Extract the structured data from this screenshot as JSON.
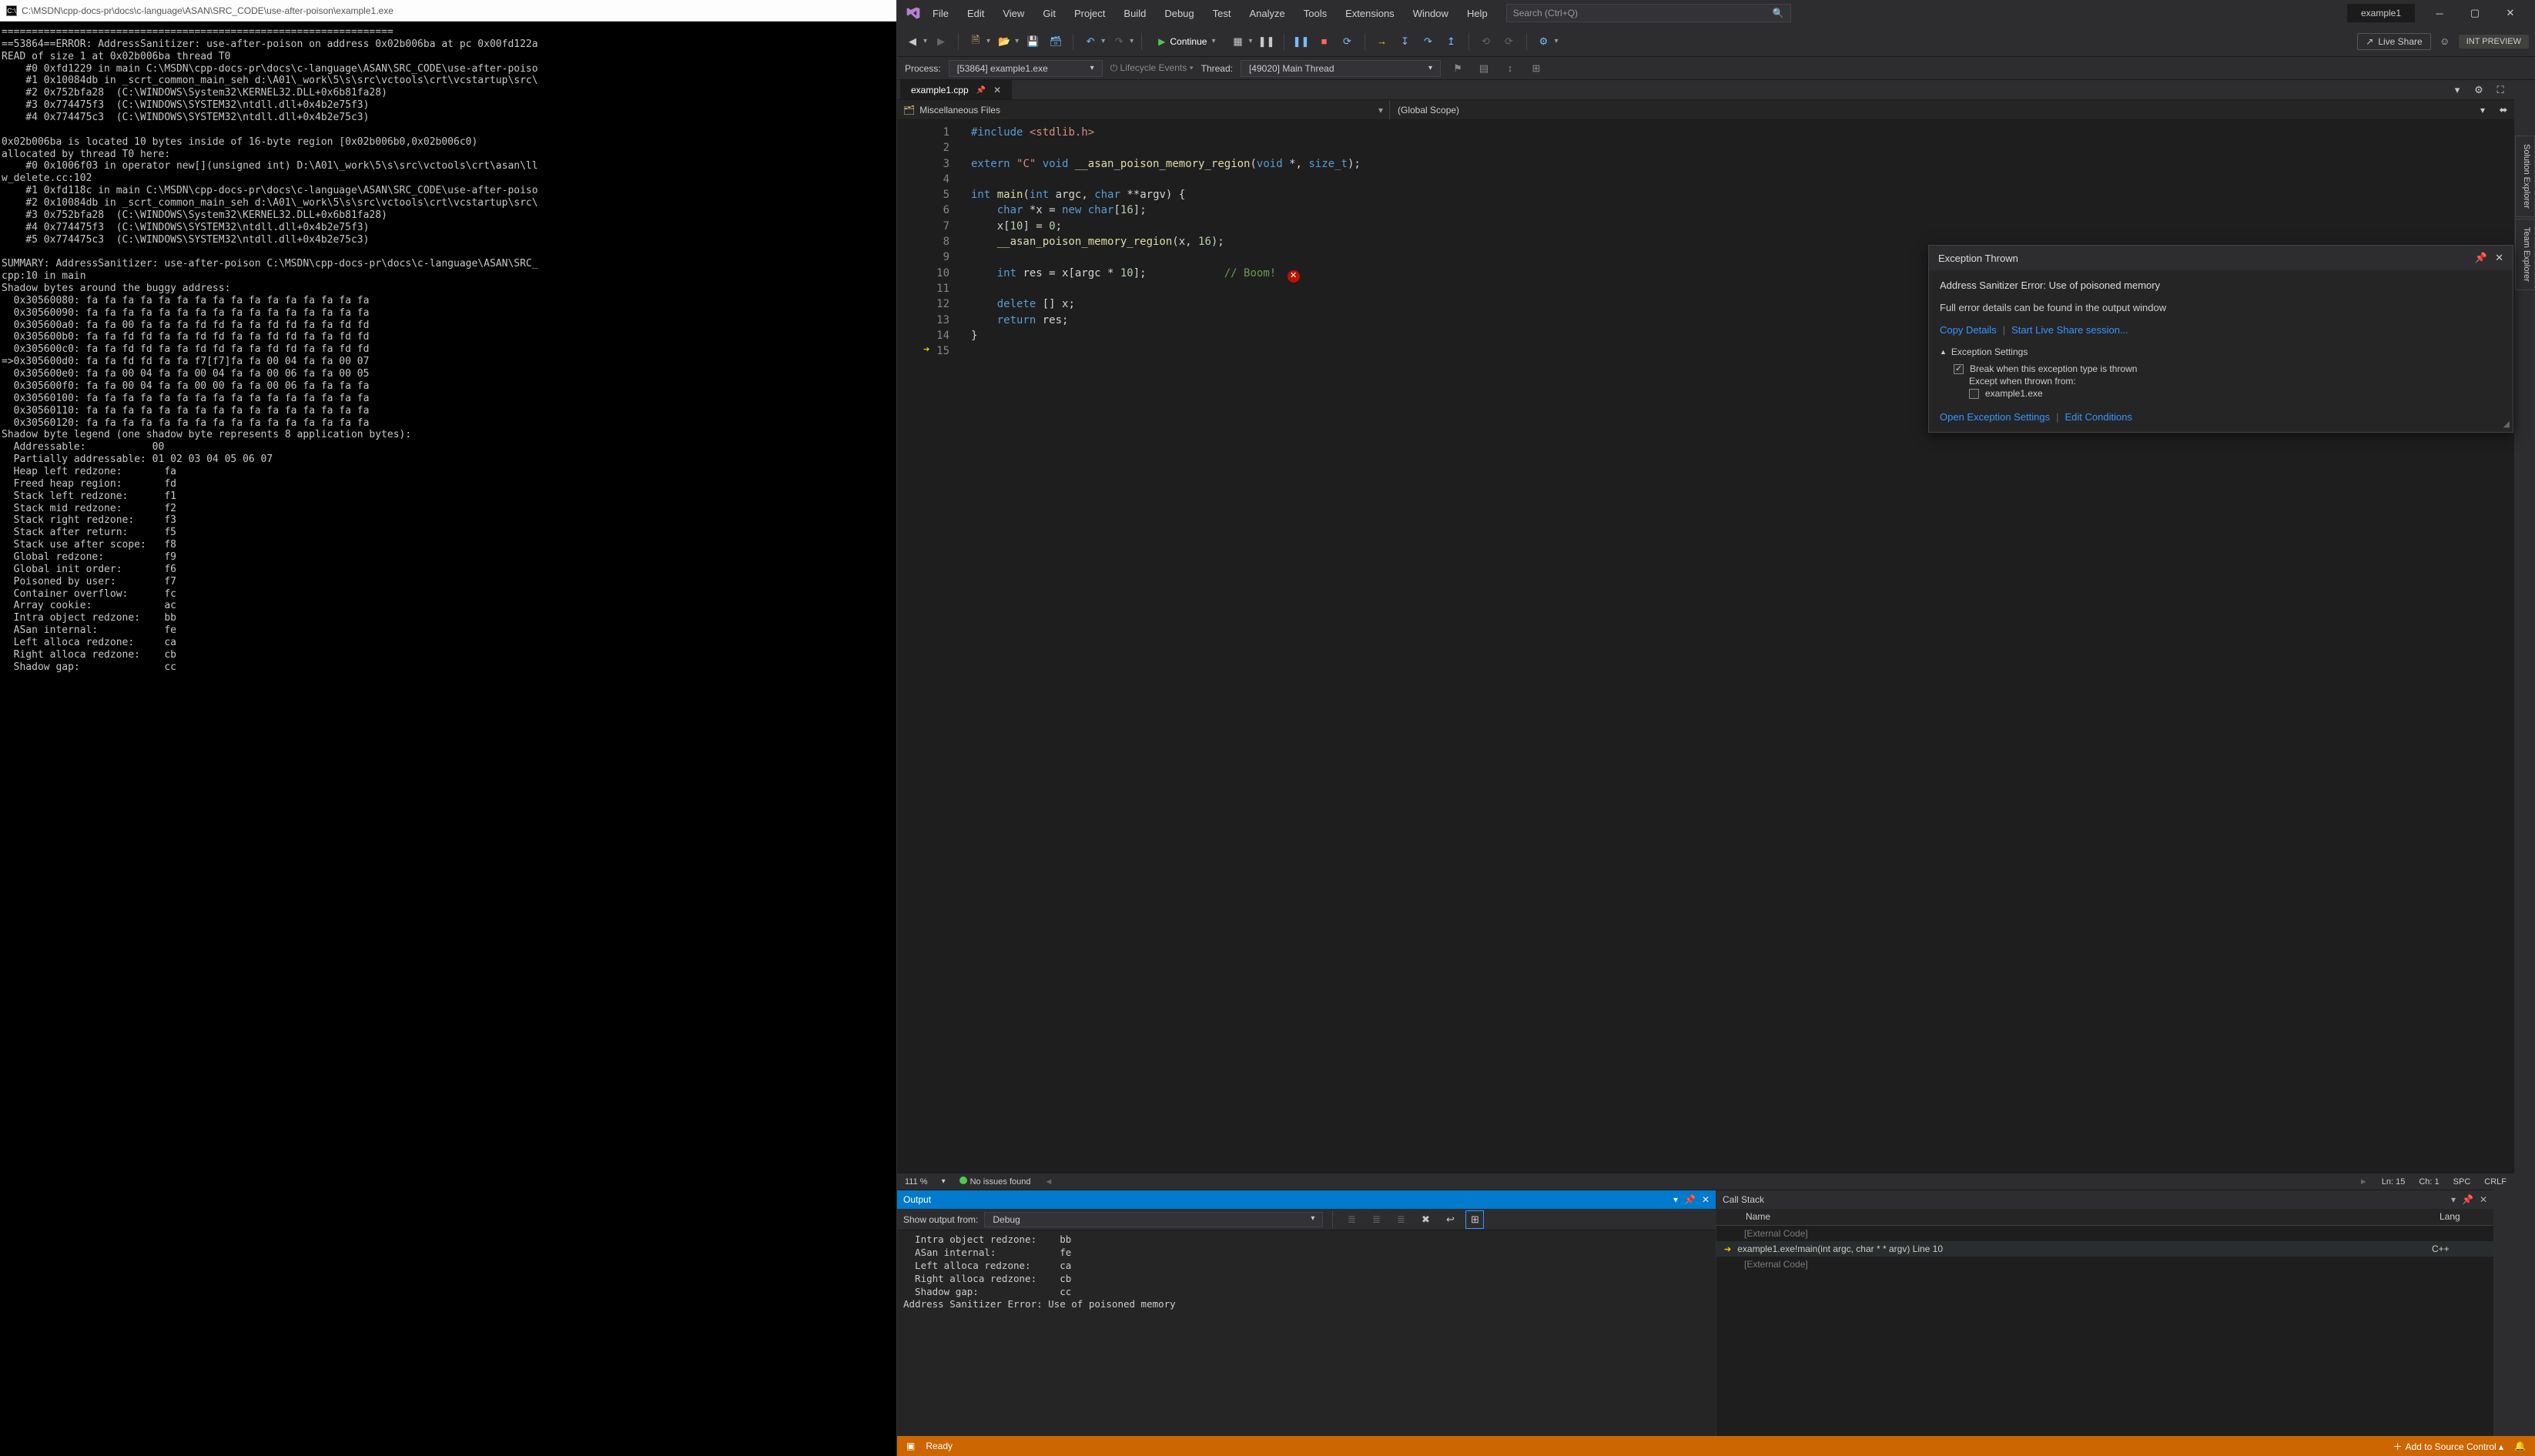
{
  "console": {
    "title_path": "C:\\MSDN\\cpp-docs-pr\\docs\\c-language\\ASAN\\SRC_CODE\\use-after-poison\\example1.exe",
    "body": "=================================================================\n==53864==ERROR: AddressSanitizer: use-after-poison on address 0x02b006ba at pc 0x00fd122a\nREAD of size 1 at 0x02b006ba thread T0\n    #0 0xfd1229 in main C:\\MSDN\\cpp-docs-pr\\docs\\c-language\\ASAN\\SRC_CODE\\use-after-poiso\n    #1 0x10084db in _scrt_common_main_seh d:\\A01\\_work\\5\\s\\src\\vctools\\crt\\vcstartup\\src\\\n    #2 0x752bfa28  (C:\\WINDOWS\\System32\\KERNEL32.DLL+0x6b81fa28)\n    #3 0x774475f3  (C:\\WINDOWS\\SYSTEM32\\ntdll.dll+0x4b2e75f3)\n    #4 0x774475c3  (C:\\WINDOWS\\SYSTEM32\\ntdll.dll+0x4b2e75c3)\n\n0x02b006ba is located 10 bytes inside of 16-byte region [0x02b006b0,0x02b006c0)\nallocated by thread T0 here:\n    #0 0x1006f03 in operator new[](unsigned int) D:\\A01\\_work\\5\\s\\src\\vctools\\crt\\asan\\ll\nw_delete.cc:102\n    #1 0xfd118c in main C:\\MSDN\\cpp-docs-pr\\docs\\c-language\\ASAN\\SRC_CODE\\use-after-poiso\n    #2 0x10084db in _scrt_common_main_seh d:\\A01\\_work\\5\\s\\src\\vctools\\crt\\vcstartup\\src\\\n    #3 0x752bfa28  (C:\\WINDOWS\\System32\\KERNEL32.DLL+0x6b81fa28)\n    #4 0x774475f3  (C:\\WINDOWS\\SYSTEM32\\ntdll.dll+0x4b2e75f3)\n    #5 0x774475c3  (C:\\WINDOWS\\SYSTEM32\\ntdll.dll+0x4b2e75c3)\n\nSUMMARY: AddressSanitizer: use-after-poison C:\\MSDN\\cpp-docs-pr\\docs\\c-language\\ASAN\\SRC_\ncpp:10 in main\nShadow bytes around the buggy address:\n  0x30560080: fa fa fa fa fa fa fa fa fa fa fa fa fa fa fa fa\n  0x30560090: fa fa fa fa fa fa fa fa fa fa fa fa fa fa fa fa\n  0x305600a0: fa fa 00 fa fa fa fd fd fa fa fd fd fa fa fd fd\n  0x305600b0: fa fa fd fd fa fa fd fd fa fa fd fd fa fa fd fd\n  0x305600c0: fa fa fd fd fa fa fd fd fa fa fd fd fa fa fd fd\n=>0x305600d0: fa fa fd fd fa fa f7[f7]fa fa 00 04 fa fa 00 07\n  0x305600e0: fa fa 00 04 fa fa 00 04 fa fa 00 06 fa fa 00 05\n  0x305600f0: fa fa 00 04 fa fa 00 00 fa fa 00 06 fa fa fa fa\n  0x30560100: fa fa fa fa fa fa fa fa fa fa fa fa fa fa fa fa\n  0x30560110: fa fa fa fa fa fa fa fa fa fa fa fa fa fa fa fa\n  0x30560120: fa fa fa fa fa fa fa fa fa fa fa fa fa fa fa fa\nShadow byte legend (one shadow byte represents 8 application bytes):\n  Addressable:           00\n  Partially addressable: 01 02 03 04 05 06 07\n  Heap left redzone:       fa\n  Freed heap region:       fd\n  Stack left redzone:      f1\n  Stack mid redzone:       f2\n  Stack right redzone:     f3\n  Stack after return:      f5\n  Stack use after scope:   f8\n  Global redzone:          f9\n  Global init order:       f6\n  Poisoned by user:        f7\n  Container overflow:      fc\n  Array cookie:            ac\n  Intra object redzone:    bb\n  ASan internal:           fe\n  Left alloca redzone:     ca\n  Right alloca redzone:    cb\n  Shadow gap:              cc"
  },
  "menu": [
    "File",
    "Edit",
    "View",
    "Git",
    "Project",
    "Build",
    "Debug",
    "Test",
    "Analyze",
    "Tools",
    "Extensions",
    "Window",
    "Help"
  ],
  "search_placeholder": "Search (Ctrl+Q)",
  "solution_tab": "example1",
  "toolbar": {
    "continue": "Continue",
    "live_share": "Live Share",
    "preview_badge": "INT PREVIEW"
  },
  "process_row": {
    "label": "Process:",
    "value": "[53864] example1.exe",
    "lifecycle": "Lifecycle Events",
    "thread_label": "Thread:",
    "thread_value": "[49020] Main Thread"
  },
  "vert_tabs": [
    "Solution Explorer",
    "Team Explorer"
  ],
  "file_tab": "example1.cpp",
  "scope": {
    "left": "Miscellaneous Files",
    "right": "(Global Scope)"
  },
  "code_lines": [
    "#include <stdlib.h>",
    "",
    "extern \"C\" void __asan_poison_memory_region(void *, size_t);",
    "",
    "int main(int argc, char **argv) {",
    "    char *x = new char[16];",
    "    x[10] = 0;",
    "    __asan_poison_memory_region(x, 16);",
    "",
    "    int res = x[argc * 10];            // Boom!",
    "",
    "    delete [] x;",
    "    return res;",
    "}",
    ""
  ],
  "editor_status": {
    "zoom": "111 %",
    "issues": "No issues found",
    "ln": "Ln: 15",
    "ch": "Ch: 1",
    "spc": "SPC",
    "crlf": "CRLF"
  },
  "exception": {
    "title": "Exception Thrown",
    "message": "Address Sanitizer Error: Use of poisoned memory",
    "detail": "Full error details can be found in the output window",
    "copy": "Copy Details",
    "start_ls": "Start Live Share session...",
    "settings_hdr": "Exception Settings",
    "break_label": "Break when this exception type is thrown",
    "except_label": "Except when thrown from:",
    "module": "example1.exe",
    "open_settings": "Open Exception Settings",
    "edit_cond": "Edit Conditions"
  },
  "output": {
    "title": "Output",
    "show_from": "Show output from:",
    "show_from_value": "Debug",
    "text": "  Intra object redzone:    bb\n  ASan internal:           fe\n  Left alloca redzone:     ca\n  Right alloca redzone:    cb\n  Shadow gap:              cc\nAddress Sanitizer Error: Use of poisoned memory"
  },
  "callstack": {
    "title": "Call Stack",
    "col_name": "Name",
    "col_lang": "Lang",
    "rows": [
      {
        "txt": "[External Code]",
        "ext": true,
        "lang": ""
      },
      {
        "txt": "example1.exe!main(int argc, char * * argv) Line 10",
        "ext": false,
        "lang": "C++",
        "cur": true
      },
      {
        "txt": "[External Code]",
        "ext": true,
        "lang": ""
      }
    ]
  },
  "footer": {
    "ready": "Ready",
    "add_src": "Add to Source Control"
  }
}
